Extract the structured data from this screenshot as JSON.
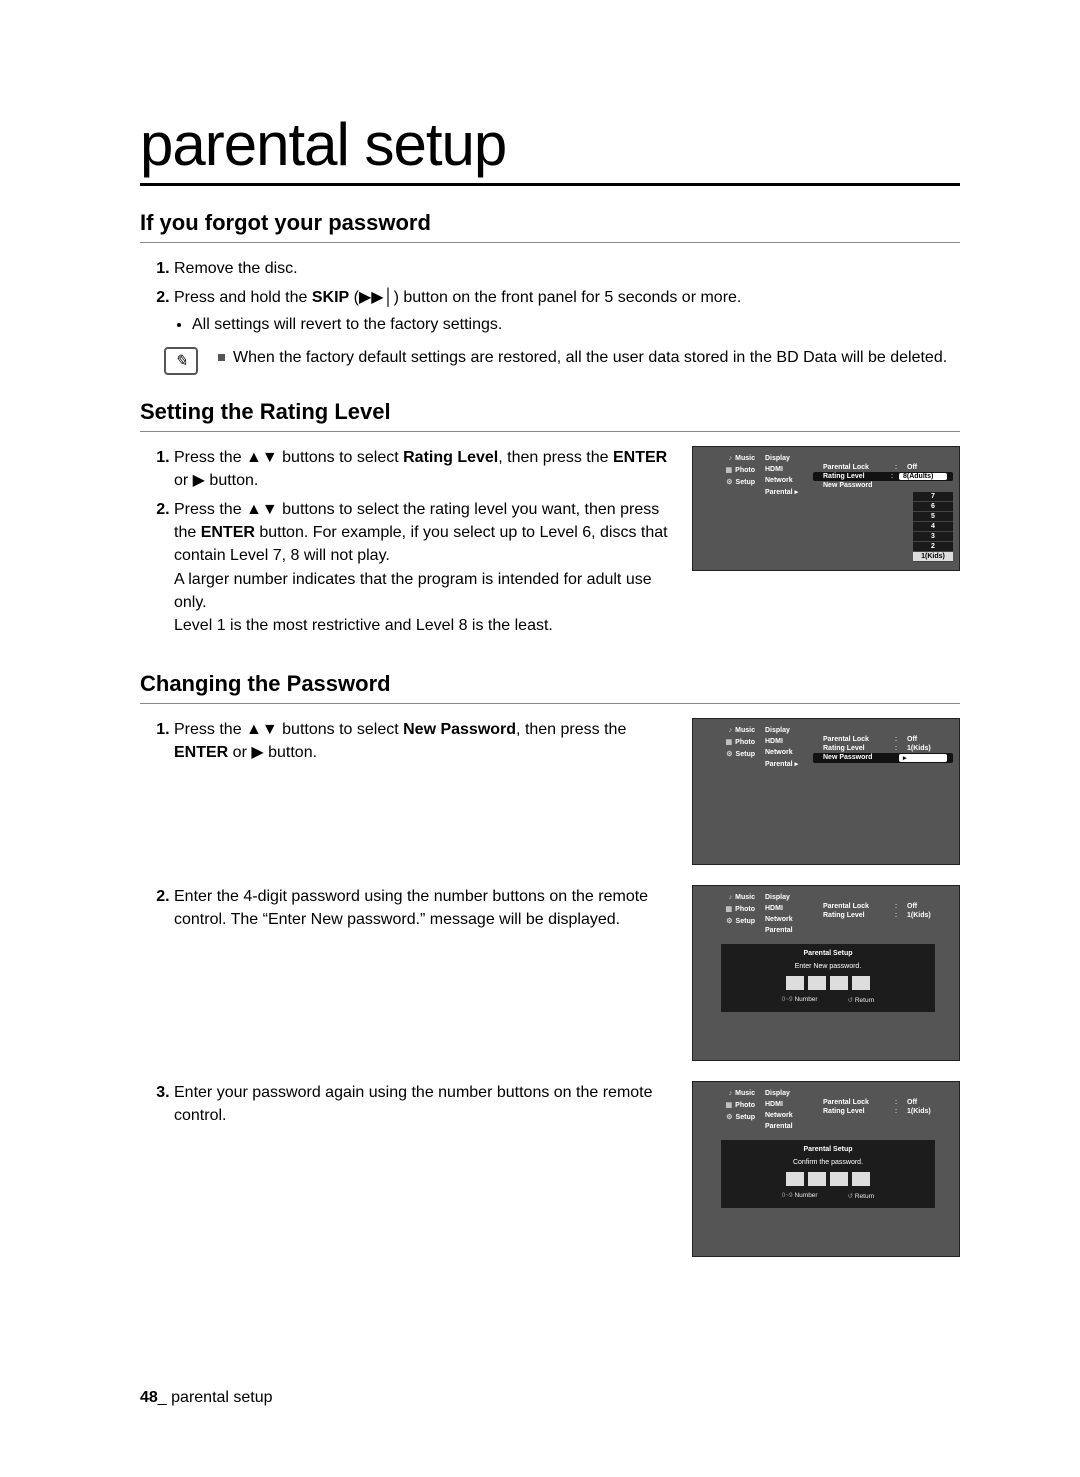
{
  "title": "parental setup",
  "sections": {
    "forgot": {
      "heading": "If you forgot your password",
      "step1": "Remove the disc.",
      "step2_pre": "Press and hold the ",
      "step2_bold": "SKIP",
      "step2_post": " button on the front panel for 5 seconds or more.",
      "step2_sub": "All settings will revert to the factory settings.",
      "note": "When the factory default settings are restored, all the user data stored in the BD Data will be deleted."
    },
    "rating": {
      "heading": "Setting the Rating Level",
      "step1_a": "Press the ",
      "step1_b": " buttons to select ",
      "step1_bold": "Rating Level",
      "step1_c": ", then press the ",
      "step1_enter": "ENTER",
      "step1_d": " or ",
      "step1_e": " button.",
      "step2_a": "Press the ",
      "step2_b": " buttons to select the rating level you want, then press the ",
      "step2_enter": "ENTER",
      "step2_c": " button. For example, if you select up to Level 6, discs that contain Level 7, 8 will not play.",
      "step2_line2": "A larger number indicates that the program is intended for adult use only.",
      "step2_line3": "Level 1 is the most restrictive and Level 8 is the least."
    },
    "password": {
      "heading": "Changing the Password",
      "step1_a": "Press the ",
      "step1_b": " buttons to select ",
      "step1_bold": "New Password",
      "step1_c": ", then press the ",
      "step1_enter": "ENTER",
      "step1_d": " or ",
      "step1_e": " button.",
      "step2": "Enter the 4-digit password using the number buttons on the remote control. The “Enter New password.” message will be displayed.",
      "step3": "Enter your password again using the number buttons on the remote control."
    }
  },
  "mock": {
    "side": {
      "music": "Music",
      "photo": "Photo",
      "setup": "Setup"
    },
    "mid": {
      "display": "Display",
      "hdmi": "HDMI",
      "network": "Network",
      "parental": "Parental"
    },
    "rows": {
      "parental_lock": "Parental Lock",
      "off": "Off",
      "rating_level": "Rating Level",
      "adults": "8(Adults)",
      "new_password": "New Password",
      "kids": "1(Kids)"
    },
    "rating_options": [
      "7",
      "6",
      "5",
      "4",
      "3",
      "2",
      "1(Kids)"
    ],
    "dialog": {
      "title": "Parental Setup",
      "enter_msg": "Enter New password.",
      "confirm_msg": "Confirm the password.",
      "hint_number": "Number",
      "hint_return": "Return"
    }
  },
  "footer": {
    "page_num": "48",
    "sep": "_ ",
    "label": "parental setup"
  }
}
